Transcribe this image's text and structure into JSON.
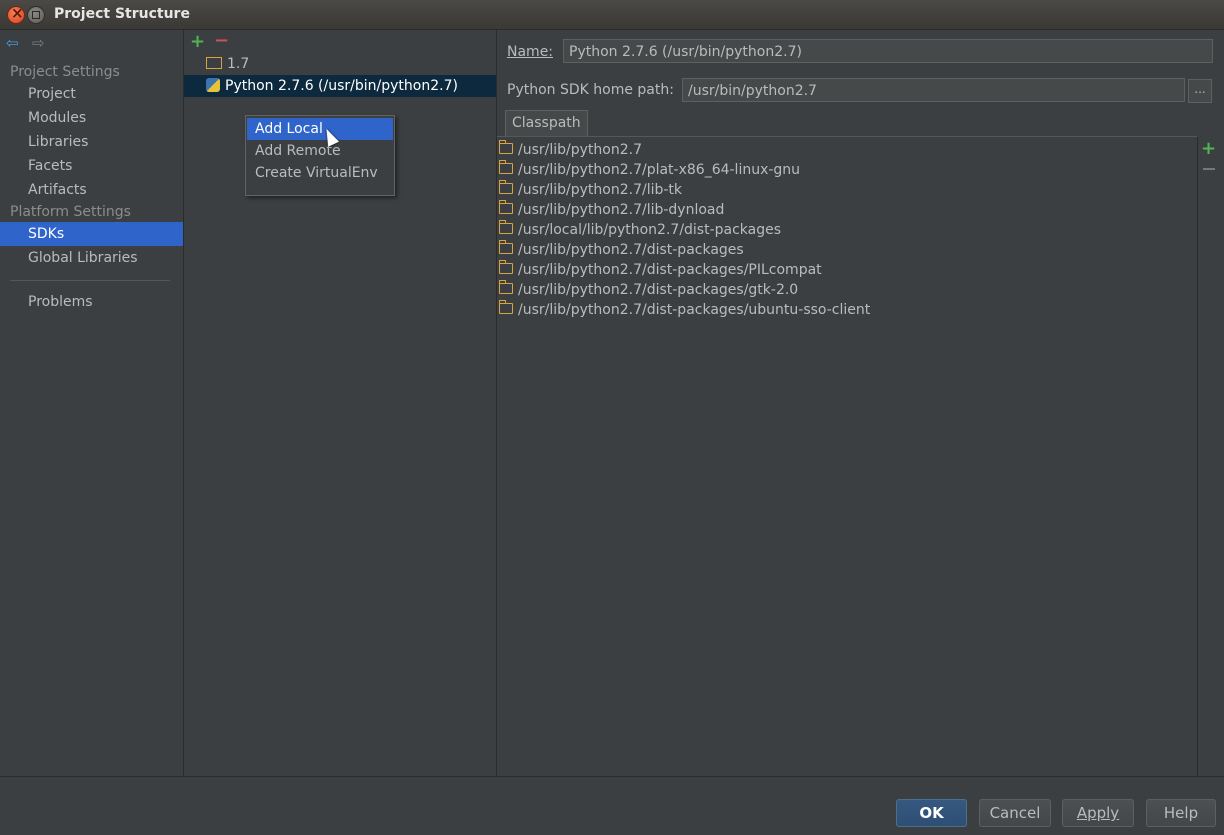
{
  "window": {
    "title": "Project Structure"
  },
  "nav": {
    "project_settings_header": "Project Settings",
    "project_settings_items": [
      "Project",
      "Modules",
      "Libraries",
      "Facets",
      "Artifacts"
    ],
    "platform_settings_header": "Platform Settings",
    "platform_settings_items": [
      "SDKs",
      "Global Libraries"
    ],
    "selected": "SDKs",
    "problems": "Problems"
  },
  "sdk_list": {
    "items": [
      "1.7",
      "Python 2.7.6 (/usr/bin/python2.7)"
    ],
    "selected": "Python 2.7.6 (/usr/bin/python2.7)"
  },
  "popup_menu": {
    "items": [
      "Add Local",
      "Add Remote",
      "Create VirtualEnv"
    ],
    "highlighted": "Add Local"
  },
  "details": {
    "name_label": "Name:",
    "name_value": "Python 2.7.6 (/usr/bin/python2.7)",
    "home_path_label": "Python SDK home path:",
    "home_path_value": "/usr/bin/python2.7",
    "browse_label": "...",
    "tab_classpath": "Classpath",
    "classpath": [
      "/usr/lib/python2.7",
      "/usr/lib/python2.7/plat-x86_64-linux-gnu",
      "/usr/lib/python2.7/lib-tk",
      "/usr/lib/python2.7/lib-dynload",
      "/usr/local/lib/python2.7/dist-packages",
      "/usr/lib/python2.7/dist-packages",
      "/usr/lib/python2.7/dist-packages/PILcompat",
      "/usr/lib/python2.7/dist-packages/gtk-2.0",
      "/usr/lib/python2.7/dist-packages/ubuntu-sso-client"
    ]
  },
  "buttons": {
    "ok": "OK",
    "cancel": "Cancel",
    "apply": "Apply",
    "help": "Help"
  },
  "icons": {
    "add": "+",
    "remove": "−",
    "back": "⇦",
    "forward": "⇨"
  },
  "colors": {
    "selection": "#2f65ca",
    "add_green": "#50b450",
    "remove_red": "#c75450",
    "folder": "#d9a343"
  }
}
